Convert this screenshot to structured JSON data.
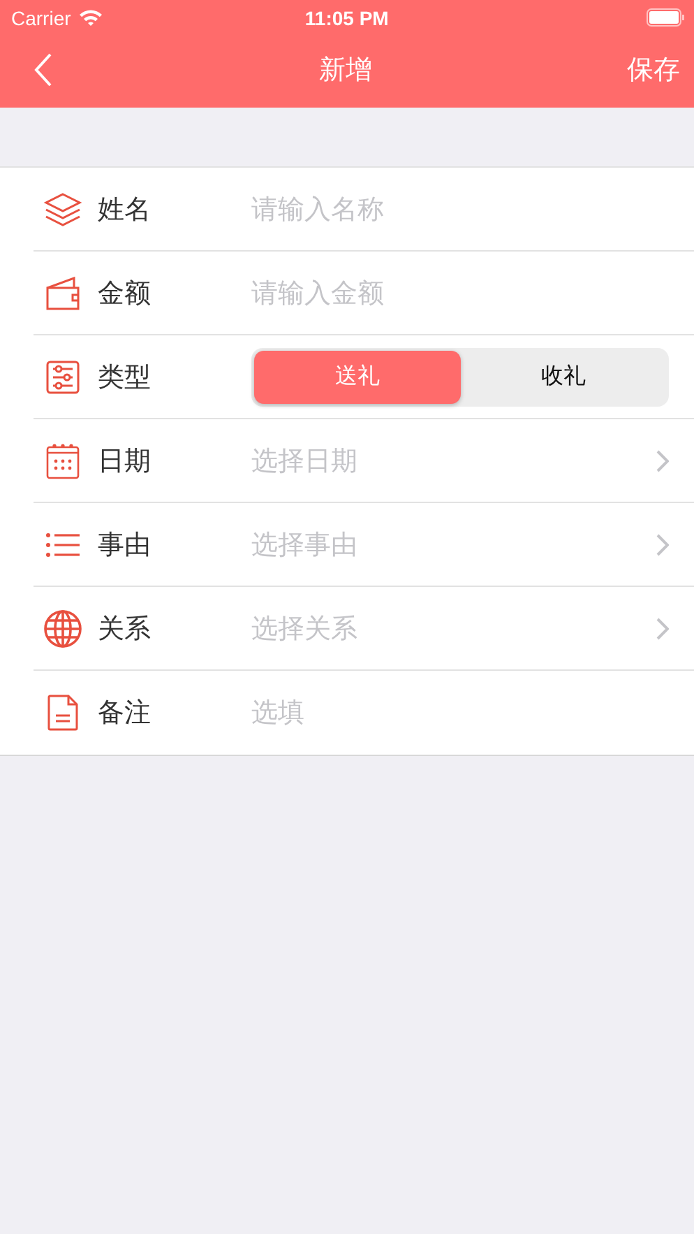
{
  "status_bar": {
    "carrier": "Carrier",
    "time": "11:05 PM"
  },
  "nav": {
    "title": "新增",
    "action": "保存"
  },
  "rows": [
    {
      "kind": "input",
      "label": "姓名",
      "placeholder": "请输入名称"
    },
    {
      "kind": "input",
      "label": "金额",
      "placeholder": "请输入金额"
    },
    {
      "kind": "segmented",
      "label": "类型",
      "options": [
        {
          "label": "送礼",
          "selected": true
        },
        {
          "label": "收礼",
          "selected": false
        }
      ]
    },
    {
      "kind": "picker",
      "label": "日期",
      "placeholder": "选择日期"
    },
    {
      "kind": "picker",
      "label": "事由",
      "placeholder": "选择事由"
    },
    {
      "kind": "picker",
      "label": "关系",
      "placeholder": "选择关系"
    },
    {
      "kind": "input",
      "label": "备注",
      "placeholder": "选填"
    }
  ]
}
